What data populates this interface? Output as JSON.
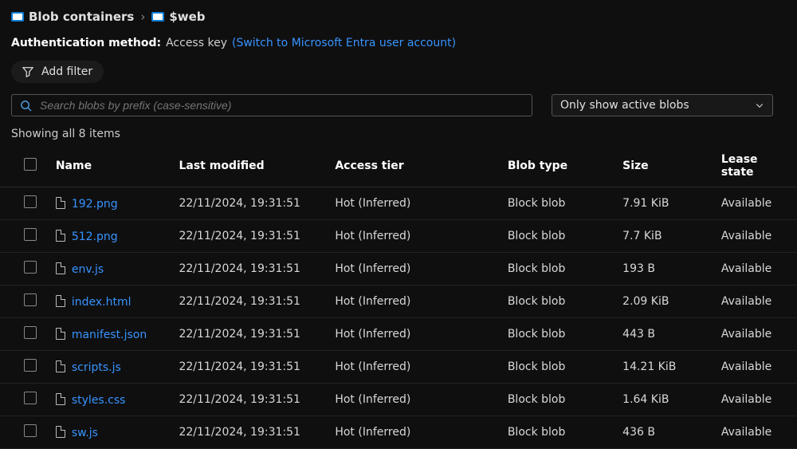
{
  "breadcrumb": {
    "parent": "Blob containers",
    "current": "$web"
  },
  "auth": {
    "label": "Authentication method:",
    "value": "Access key",
    "switch_link": "(Switch to Microsoft Entra user account)"
  },
  "filter": {
    "add_label": "Add filter"
  },
  "search": {
    "placeholder": "Search blobs by prefix (case-sensitive)"
  },
  "view_filter": {
    "selected": "Only show active blobs"
  },
  "count_line": "Showing all 8 items",
  "columns": {
    "name": "Name",
    "modified": "Last modified",
    "tier": "Access tier",
    "type": "Blob type",
    "size": "Size",
    "lease": "Lease state"
  },
  "rows": [
    {
      "name": "192.png",
      "modified": "22/11/2024, 19:31:51",
      "tier": "Hot (Inferred)",
      "type": "Block blob",
      "size": "7.91 KiB",
      "lease": "Available"
    },
    {
      "name": "512.png",
      "modified": "22/11/2024, 19:31:51",
      "tier": "Hot (Inferred)",
      "type": "Block blob",
      "size": "7.7 KiB",
      "lease": "Available"
    },
    {
      "name": "env.js",
      "modified": "22/11/2024, 19:31:51",
      "tier": "Hot (Inferred)",
      "type": "Block blob",
      "size": "193 B",
      "lease": "Available"
    },
    {
      "name": "index.html",
      "modified": "22/11/2024, 19:31:51",
      "tier": "Hot (Inferred)",
      "type": "Block blob",
      "size": "2.09 KiB",
      "lease": "Available"
    },
    {
      "name": "manifest.json",
      "modified": "22/11/2024, 19:31:51",
      "tier": "Hot (Inferred)",
      "type": "Block blob",
      "size": "443 B",
      "lease": "Available"
    },
    {
      "name": "scripts.js",
      "modified": "22/11/2024, 19:31:51",
      "tier": "Hot (Inferred)",
      "type": "Block blob",
      "size": "14.21 KiB",
      "lease": "Available"
    },
    {
      "name": "styles.css",
      "modified": "22/11/2024, 19:31:51",
      "tier": "Hot (Inferred)",
      "type": "Block blob",
      "size": "1.64 KiB",
      "lease": "Available"
    },
    {
      "name": "sw.js",
      "modified": "22/11/2024, 19:31:51",
      "tier": "Hot (Inferred)",
      "type": "Block blob",
      "size": "436 B",
      "lease": "Available"
    }
  ]
}
